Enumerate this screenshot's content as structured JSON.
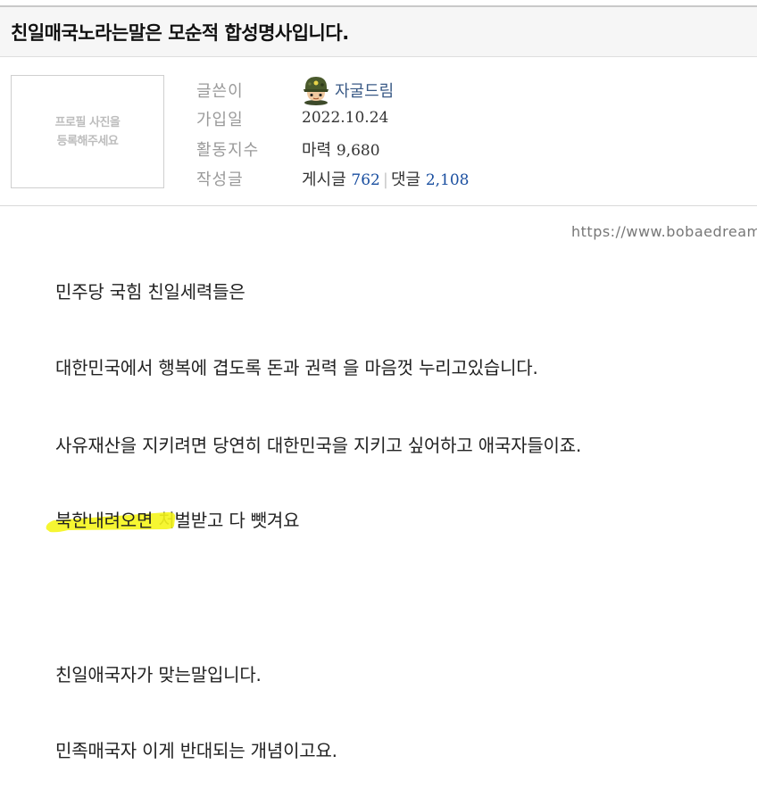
{
  "post": {
    "title": "친일매국노라는말은 모순적 합성명사입니다."
  },
  "profile": {
    "photo_placeholder_line1": "프로필 사진을",
    "photo_placeholder_line2": "등록해주세요",
    "labels": {
      "author": "글쓴이",
      "joined": "가입일",
      "activity": "활동지수",
      "posts": "작성글"
    },
    "author_name": "자굴드림",
    "joined_date": "2022.10.24",
    "activity_label": "마력",
    "activity_value": "9,680",
    "posts_label": "게시글",
    "posts_count": "762",
    "comments_label": "댓글",
    "comments_count": "2,108"
  },
  "source_url": "https://www.bobaedream",
  "body": {
    "line1": "민주당 국힘 친일세력들은",
    "line2": "대한민국에서 행복에 겹도록  돈과 권력 을 마음껏 누리고있습니다.",
    "line3": "사유재산을 지키려면  당연히 대한민국을 지키고  싶어하고 애국자들이죠.",
    "line4_highlight": "북한내려오면",
    "line4_rest": " 처벌받고 다 뺏겨요",
    "line5": "친일애국자가 맞는말입니다.",
    "line6": "민족매국자 이게 반대되는 개념이고요."
  },
  "colors": {
    "highlight": "#f5f51c",
    "count_blue": "#1a4fa0",
    "label_gray": "#9a9a9a"
  },
  "icons": {
    "avatar": "soldier-avatar-icon"
  }
}
